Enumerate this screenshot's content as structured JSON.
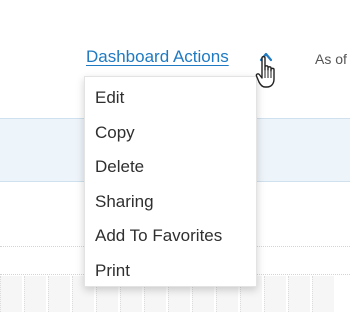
{
  "header": {
    "actions_label": "Dashboard Actions",
    "as_of_label": "As of"
  },
  "menu": {
    "items": [
      {
        "label": "Edit"
      },
      {
        "label": "Copy"
      },
      {
        "label": "Delete"
      },
      {
        "label": "Sharing"
      },
      {
        "label": "Add To Favorites"
      },
      {
        "label": "Print"
      }
    ]
  },
  "icons": {
    "toggle": "chevron-up-icon",
    "pointer": "hand-pointer-icon"
  },
  "colors": {
    "link": "#1f7ac2",
    "band": "#edf4fa"
  }
}
